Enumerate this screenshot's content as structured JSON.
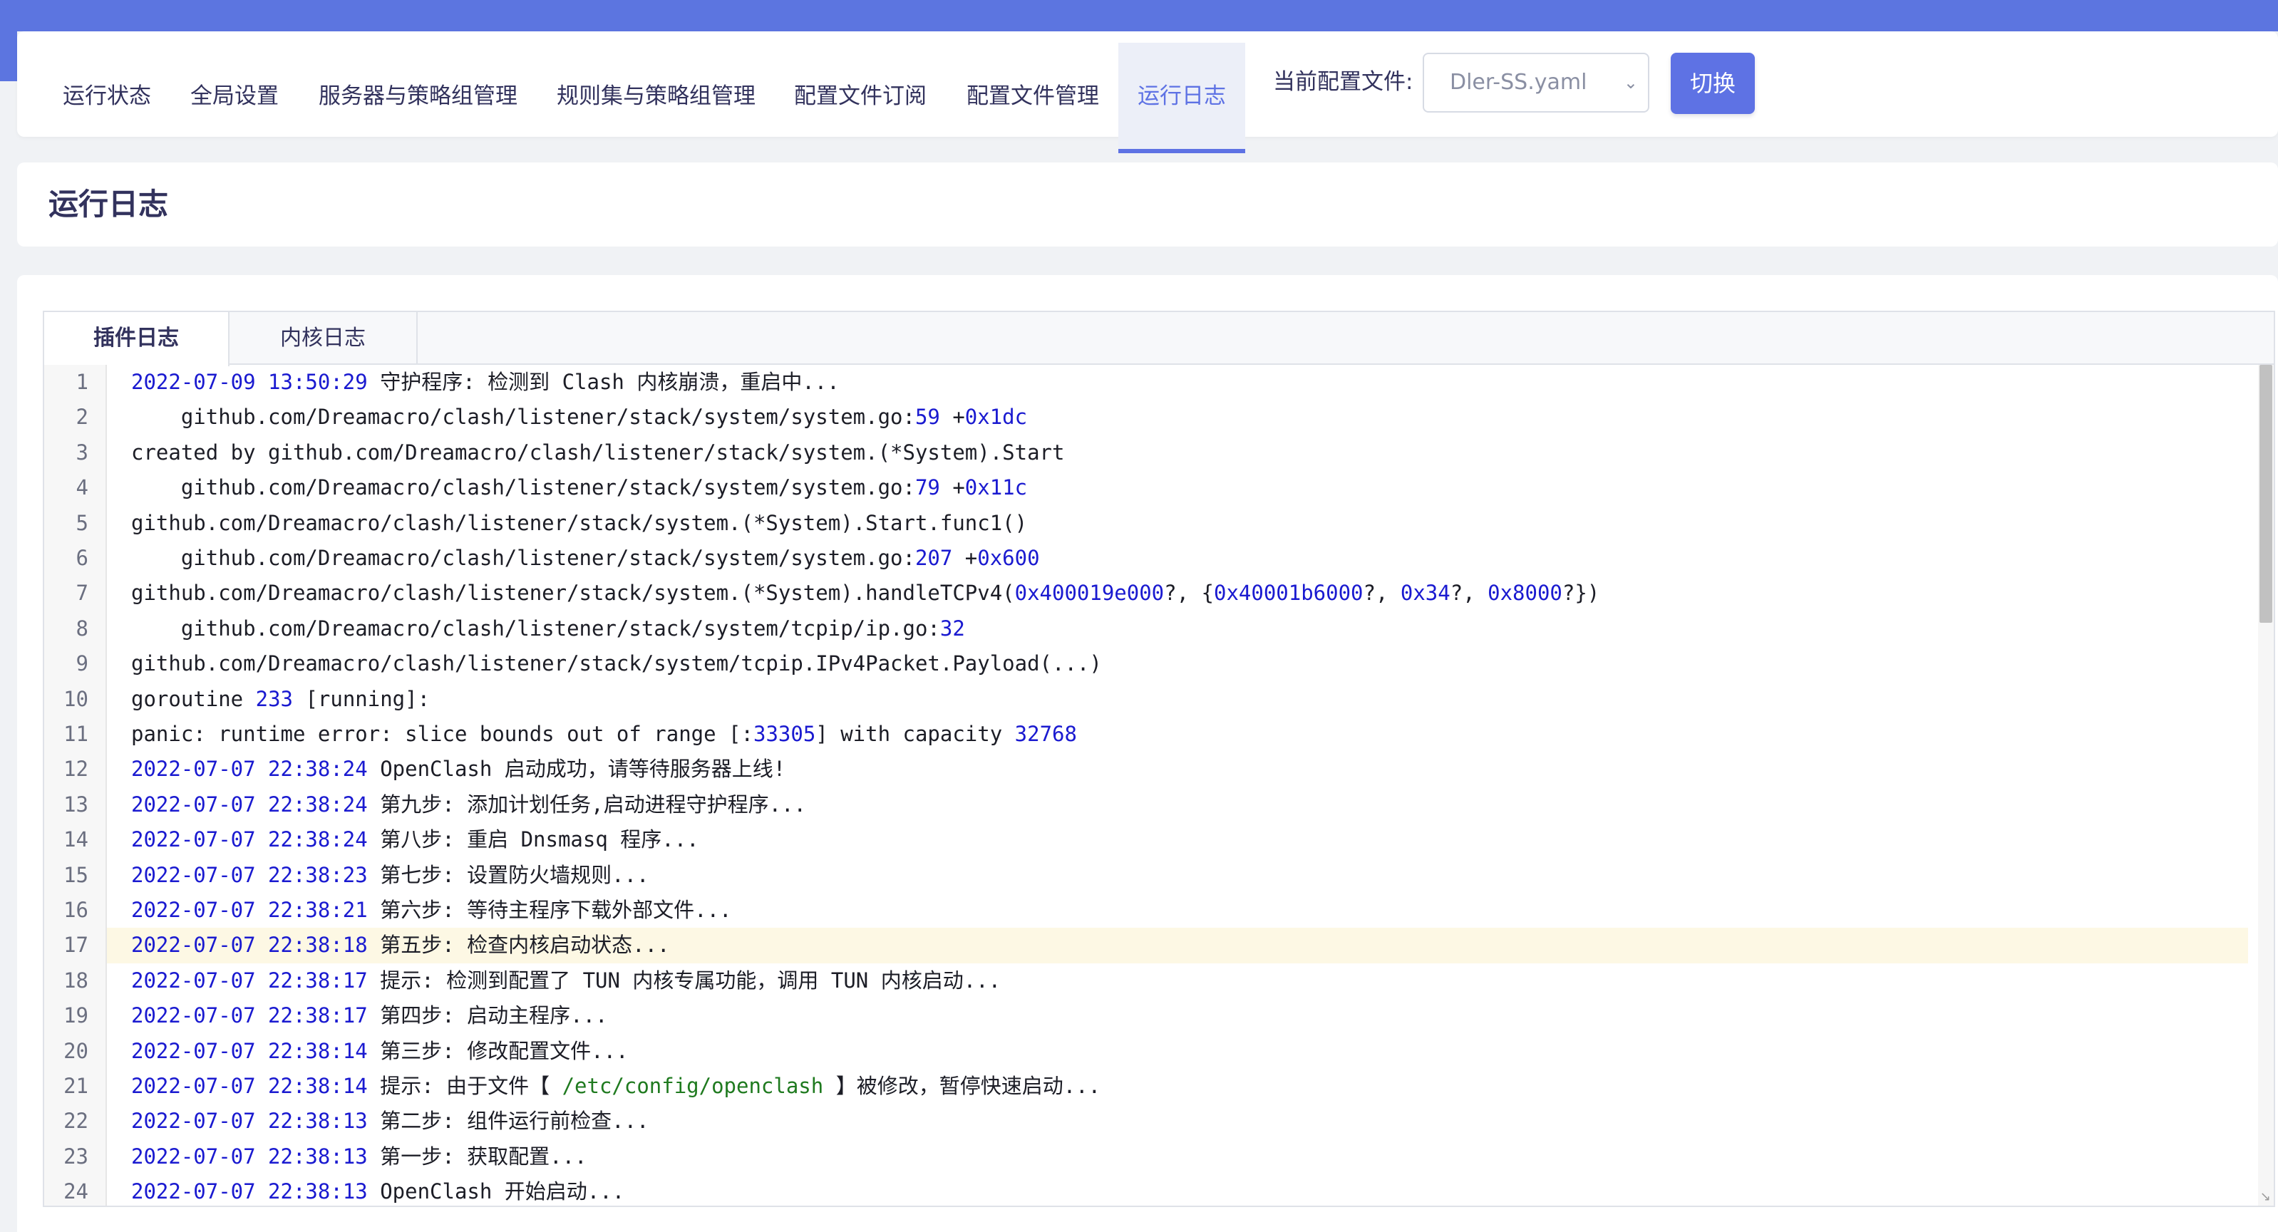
{
  "nav": {
    "tabs": [
      "运行状态",
      "全局设置",
      "服务器与策略组管理",
      "规则集与策略组管理",
      "配置文件订阅",
      "配置文件管理",
      "运行日志"
    ],
    "active_tab": "运行日志",
    "config_label": "当前配置文件:",
    "config_value": "Dler-SS.yaml",
    "switch_label": "切换"
  },
  "page_title": "运行日志",
  "log_tabs": [
    "插件日志",
    "内核日志"
  ],
  "active_log_tab": "插件日志",
  "log_lines": [
    "2022-07-09 13:50:29 守护程序: 检测到 Clash 内核崩溃，重启中...",
    "    github.com/Dreamacro/clash/listener/stack/system/system.go:59 +0x1dc",
    "created by github.com/Dreamacro/clash/listener/stack/system.(*System).Start",
    "    github.com/Dreamacro/clash/listener/stack/system/system.go:79 +0x11c",
    "github.com/Dreamacro/clash/listener/stack/system.(*System).Start.func1()",
    "    github.com/Dreamacro/clash/listener/stack/system/system.go:207 +0x600",
    "github.com/Dreamacro/clash/listener/stack/system.(*System).handleTCPv4(0x400019e000?, {0x40001b6000?, 0x34?, 0x8000?})",
    "    github.com/Dreamacro/clash/listener/stack/system/tcpip/ip.go:32",
    "github.com/Dreamacro/clash/listener/stack/system/tcpip.IPv4Packet.Payload(...)",
    "goroutine 233 [running]:",
    "panic: runtime error: slice bounds out of range [:33305] with capacity 32768",
    "2022-07-07 22:38:24 OpenClash 启动成功，请等待服务器上线!",
    "2022-07-07 22:38:24 第九步: 添加计划任务,启动进程守护程序...",
    "2022-07-07 22:38:24 第八步: 重启 Dnsmasq 程序...",
    "2022-07-07 22:38:23 第七步: 设置防火墙规则...",
    "2022-07-07 22:38:21 第六步: 等待主程序下载外部文件...",
    "2022-07-07 22:38:18 第五步: 检查内核启动状态...",
    "2022-07-07 22:38:17 提示: 检测到配置了 TUN 内核专属功能，调用 TUN 内核启动...",
    "2022-07-07 22:38:17 第四步: 启动主程序...",
    "2022-07-07 22:38:14 第三步: 修改配置文件...",
    "2022-07-07 22:38:14 提示: 由于文件【 /etc/config/openclash 】被修改，暂停快速启动...",
    "2022-07-07 22:38:13 第二步: 组件运行前检查...",
    "2022-07-07 22:38:13 第一步: 获取配置...",
    "2022-07-07 22:38:13 OpenClash 开始启动..."
  ],
  "highlighted_line": 17,
  "colors": {
    "accent": "#5e72e4",
    "number": "#1a1ad0",
    "path": "#1f7a1f",
    "highlight": "#fdf8e4"
  }
}
